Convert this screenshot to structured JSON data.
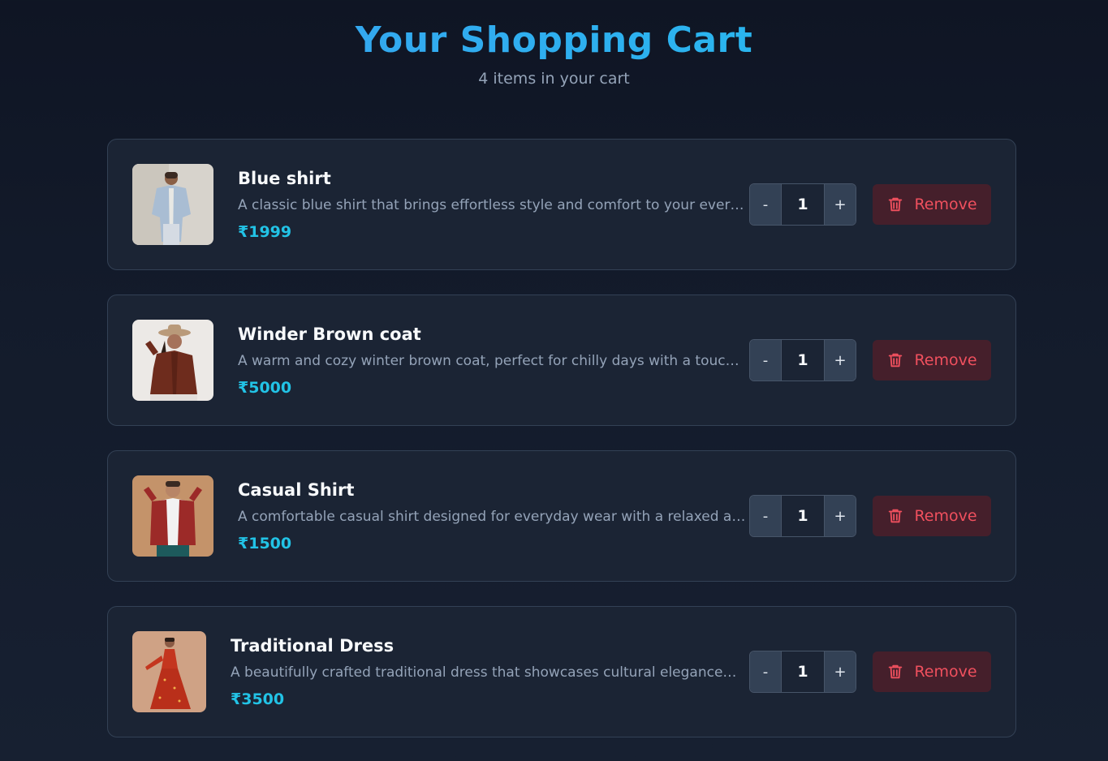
{
  "header": {
    "title": "Your Shopping Cart",
    "subtitle": "4 items in your cart"
  },
  "theme": {
    "accent": "#22c3e6",
    "danger": "#f0505e",
    "card_bg": "#1b2434"
  },
  "cart": {
    "items": [
      {
        "name": "Blue shirt",
        "description": "A classic blue shirt that brings effortless style and comfort to your everyday look.",
        "price": "₹1999",
        "quantity": "1",
        "decrement_label": "-",
        "increment_label": "+",
        "remove_label": "Remove",
        "image_icon": "product-photo-blue-shirt"
      },
      {
        "name": "Winder Brown coat",
        "description": "A warm and cozy winter brown coat, perfect for chilly days with a touch of...",
        "price": "₹5000",
        "quantity": "1",
        "decrement_label": "-",
        "increment_label": "+",
        "remove_label": "Remove",
        "image_icon": "product-photo-brown-coat"
      },
      {
        "name": "Casual Shirt",
        "description": "A comfortable casual shirt designed for everyday wear with a relaxed and mode...",
        "price": "₹1500",
        "quantity": "1",
        "decrement_label": "-",
        "increment_label": "+",
        "remove_label": "Remove",
        "image_icon": "product-photo-casual-shirt"
      },
      {
        "name": "Traditional Dress",
        "description": "A beautifully crafted traditional dress that showcases cultural elegance and...",
        "price": "₹3500",
        "quantity": "1",
        "decrement_label": "-",
        "increment_label": "+",
        "remove_label": "Remove",
        "image_icon": "product-photo-traditional-dress"
      }
    ]
  }
}
